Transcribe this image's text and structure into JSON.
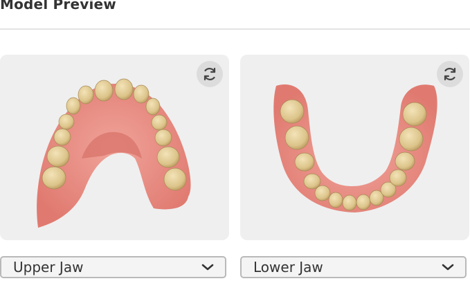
{
  "header": {
    "title": "Model Preview"
  },
  "previews": [
    {
      "id": "upper",
      "rotate_icon": "rotate-icon",
      "selected_option": "Upper Jaw"
    },
    {
      "id": "lower",
      "rotate_icon": "rotate-icon",
      "selected_option": "Lower Jaw"
    }
  ],
  "colors": {
    "card_bg": "#efefef",
    "gum": "#e8837a",
    "tooth": "#e3cf9a"
  }
}
